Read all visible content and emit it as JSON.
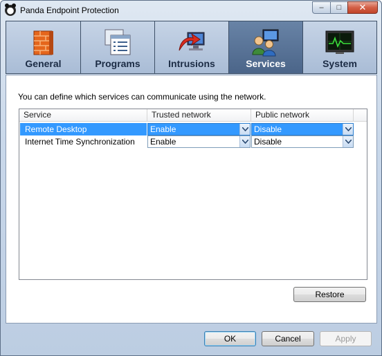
{
  "window": {
    "title": "Panda Endpoint Protection",
    "icon": "panda-icon"
  },
  "caption_buttons": {
    "minimize": "–",
    "maximize": "□",
    "close": "✕"
  },
  "tabs": [
    {
      "id": "general",
      "label": "General",
      "icon": "firewall-brick-icon"
    },
    {
      "id": "programs",
      "label": "Programs",
      "icon": "programs-list-icon"
    },
    {
      "id": "intrusions",
      "label": "Intrusions",
      "icon": "intrusion-arrow-icon"
    },
    {
      "id": "services",
      "label": "Services",
      "icon": "services-users-icon",
      "active": true
    },
    {
      "id": "system",
      "label": "System",
      "icon": "system-monitor-icon"
    }
  ],
  "panel": {
    "instructions": "You can define which services can communicate using the network.",
    "table": {
      "headers": [
        "Service",
        "Trusted network",
        "Public network"
      ],
      "rows": [
        {
          "service": "Remote Desktop",
          "trusted": "Enable",
          "public": "Disable",
          "selected": true
        },
        {
          "service": "Internet Time Synchronization",
          "trusted": "Enable",
          "public": "Disable",
          "selected": false
        }
      ]
    },
    "restore_label": "Restore"
  },
  "footer": {
    "ok_label": "OK",
    "cancel_label": "Cancel",
    "apply_label": "Apply"
  }
}
